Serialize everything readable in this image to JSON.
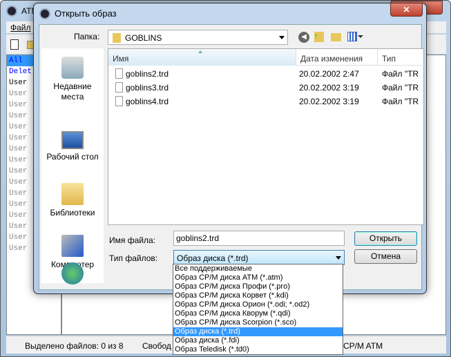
{
  "app": {
    "title": "ATM",
    "menu": [
      "Файл"
    ],
    "list": [
      "All",
      "Delet",
      "User",
      "User",
      "User",
      "User",
      "User",
      "User",
      "User",
      "User",
      "User",
      "User",
      "User",
      "User",
      "User",
      "User",
      "User",
      "User"
    ],
    "status": {
      "selected": "Выделено файлов: 0 из 8",
      "free": "Свобод",
      "format": "CP/M ATM"
    }
  },
  "dialog": {
    "title": "Открыть образ",
    "folder_label": "Папка:",
    "folder": "GOBLINS",
    "places": [
      "Недавние места",
      "Рабочий стол",
      "Библиотеки",
      "Компьютер"
    ],
    "columns": [
      "Имя",
      "Дата изменения",
      "Тип"
    ],
    "files": [
      {
        "name": "goblins2.trd",
        "date": "20.02.2002 2:47",
        "type": "Файл \"TR"
      },
      {
        "name": "goblins3.trd",
        "date": "20.02.2002 3:19",
        "type": "Файл \"TR"
      },
      {
        "name": "goblins4.trd",
        "date": "20.02.2002 3:19",
        "type": "Файл \"TR"
      }
    ],
    "filename_label": "Имя файла:",
    "filename": "goblins2.trd",
    "filetype_label": "Тип файлов:",
    "filetype": "Образ диска (*.trd)",
    "open_label": "Открыть",
    "cancel_label": "Отмена",
    "filetype_options": [
      "Все поддерживаемые",
      "Образ CP/M диска ATM (*.atm)",
      "Образ CP/M диска Профи (*.pro)",
      "Образ CP/M диска Корвет (*.kdi)",
      "Образ CP/M диска Орион (*.odi; *.od2)",
      "Образ CP/M диска Кворум (*.qdi)",
      "Образ CP/M диска Scorpion (*.sco)",
      "Образ диска (*.trd)",
      "Образ диска (*.fdi)",
      "Образ Teledisk (*.td0)"
    ],
    "selected_option": 7
  }
}
